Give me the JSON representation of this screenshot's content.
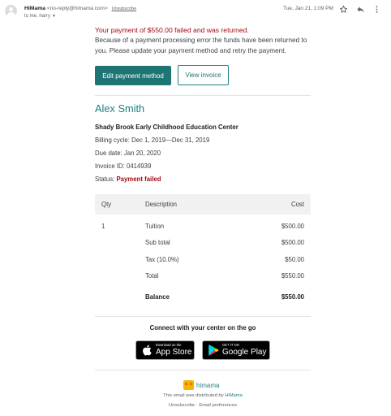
{
  "header": {
    "sender_name": "HiMama",
    "sender_email": "<no-reply@himama.com>",
    "unsubscribe": "Unsubscribe",
    "to_line": "to me, harry",
    "date": "Tue, Jan 21, 1:09 PM",
    "icons": [
      "avatar-icon",
      "star-icon",
      "reply-icon",
      "more-vert-icon"
    ]
  },
  "message": {
    "fail_headline": "Your payment of $550.00 failed and was returned.",
    "fail_detail": "Because of a payment processing error the funds have been returned to you. Please update your payment method and retry the payment.",
    "primary_button": "Edit payment method",
    "secondary_button": "View invoice"
  },
  "invoice": {
    "customer_name": "Alex Smith",
    "center_name": "Shady Brook Early Childhood Education Center",
    "billing_cycle": "Billing cycle: Dec 1, 2019—Dec 31, 2019",
    "due_date": "Due date: Jan 20, 2020",
    "invoice_id": "Invoice ID: 0414939",
    "status_label": "Status: ",
    "status_value": "Payment failed",
    "columns": {
      "qty": "Qty",
      "description": "Description",
      "cost": "Cost"
    },
    "line_item": {
      "qty": "1",
      "description": "Tuition",
      "cost": "$500.00"
    },
    "sub_total": {
      "label": "Sub total",
      "value": "$500.00"
    },
    "tax": {
      "label": "Tax (10.0%)",
      "value": "$50.00"
    },
    "total": {
      "label": "Total",
      "value": "$550.00"
    },
    "balance": {
      "label": "Balance",
      "value": "$550.00"
    }
  },
  "footer": {
    "connect_text": "Connect with your center on the go",
    "app_store_small": "Download on the",
    "app_store_big": "App Store",
    "google_play_small": "GET IT ON",
    "google_play_big": "Google Play",
    "logo_text": "himama",
    "distributed_prefix": "This email was distributed by ",
    "distributed_link": "HiMama",
    "unsubscribe": "Unsubscribe",
    "separator": "·",
    "email_prefs": "Email preferences"
  },
  "colors": {
    "accent": "#1f7474",
    "error": "#a30a16",
    "table_header_bg": "#f1f1f1"
  }
}
